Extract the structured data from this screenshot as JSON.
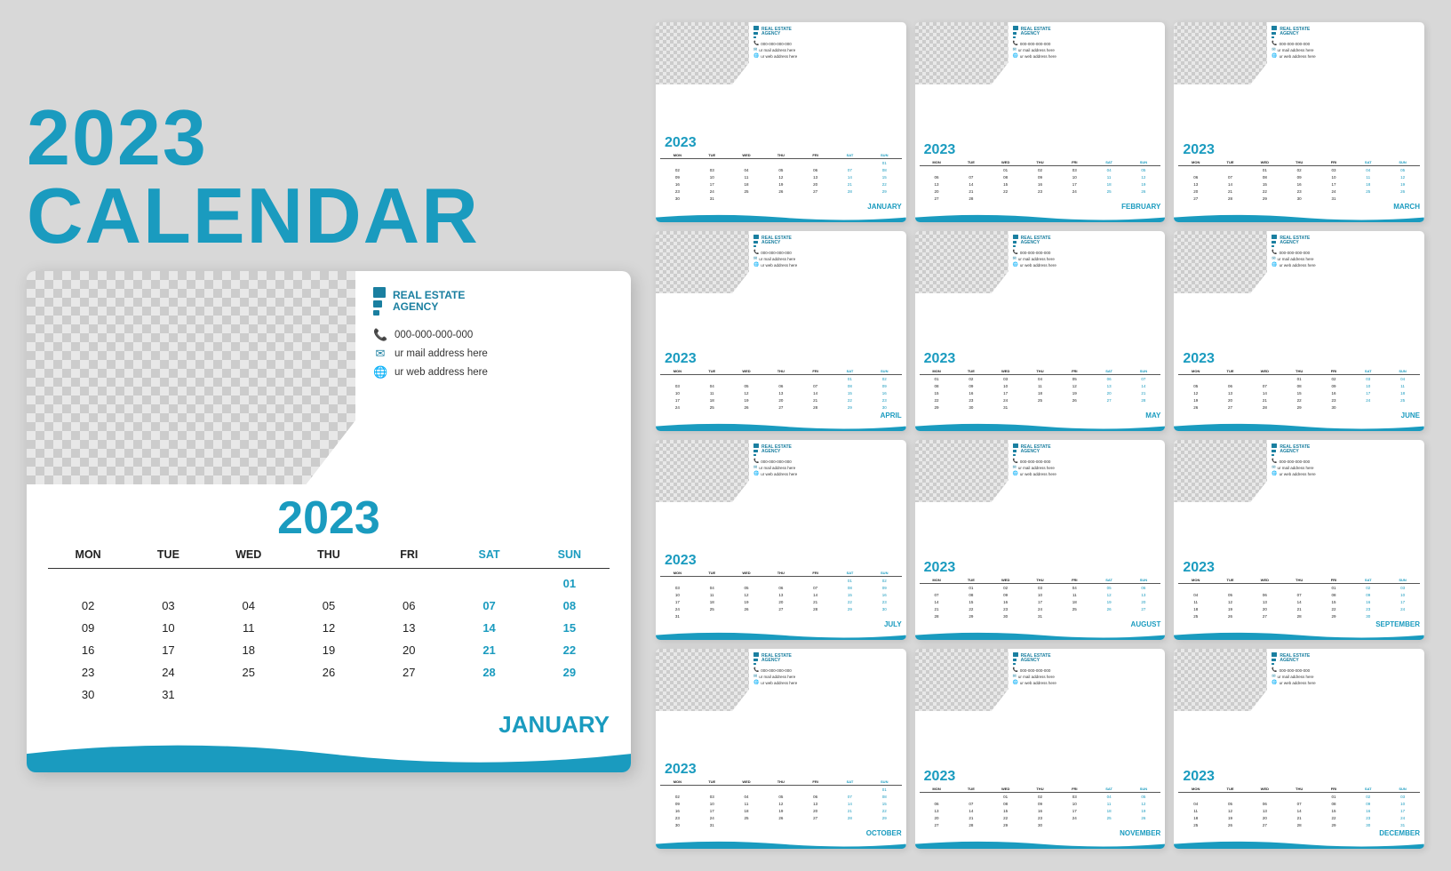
{
  "title": "2023 CALENDAR",
  "accent": "#1a9bbf",
  "bg": "#d8d8d8",
  "agency": {
    "name_line1": "REAL ESTATE",
    "name_line2": "AGENCY",
    "phone": "000-000-000-000",
    "email": "ur mail address here",
    "web": "ur web address here"
  },
  "main_year": "2023",
  "days": [
    "MON",
    "TUE",
    "WED",
    "THU",
    "FRI",
    "SAT",
    "SUN"
  ],
  "main_month": "JANUARY",
  "main_dates": [
    {
      "day": "",
      "weekend": false
    },
    {
      "day": "",
      "weekend": false
    },
    {
      "day": "",
      "weekend": false
    },
    {
      "day": "",
      "weekend": false
    },
    {
      "day": "",
      "weekend": false
    },
    {
      "day": "",
      "weekend": false
    },
    {
      "day": "01",
      "weekend": true
    },
    {
      "day": "02",
      "weekend": false
    },
    {
      "day": "03",
      "weekend": false
    },
    {
      "day": "04",
      "weekend": false
    },
    {
      "day": "05",
      "weekend": false
    },
    {
      "day": "06",
      "weekend": false
    },
    {
      "day": "07",
      "weekend": true
    },
    {
      "day": "08",
      "weekend": true
    },
    {
      "day": "09",
      "weekend": false
    },
    {
      "day": "10",
      "weekend": false
    },
    {
      "day": "11",
      "weekend": false
    },
    {
      "day": "12",
      "weekend": false
    },
    {
      "day": "13",
      "weekend": false
    },
    {
      "day": "14",
      "weekend": true
    },
    {
      "day": "15",
      "weekend": true
    },
    {
      "day": "16",
      "weekend": false
    },
    {
      "day": "17",
      "weekend": false
    },
    {
      "day": "18",
      "weekend": false
    },
    {
      "day": "19",
      "weekend": false
    },
    {
      "day": "20",
      "weekend": false
    },
    {
      "day": "21",
      "weekend": true
    },
    {
      "day": "22",
      "weekend": true
    },
    {
      "day": "23",
      "weekend": false
    },
    {
      "day": "24",
      "weekend": false
    },
    {
      "day": "25",
      "weekend": false
    },
    {
      "day": "26",
      "weekend": false
    },
    {
      "day": "27",
      "weekend": false
    },
    {
      "day": "28",
      "weekend": true
    },
    {
      "day": "29",
      "weekend": true
    },
    {
      "day": "30",
      "weekend": false
    },
    {
      "day": "31",
      "weekend": false
    },
    {
      "day": "",
      "weekend": false
    },
    {
      "day": "",
      "weekend": false
    },
    {
      "day": "",
      "weekend": false
    },
    {
      "day": "",
      "weekend": false
    },
    {
      "day": "",
      "weekend": false
    }
  ],
  "mini_calendars": [
    {
      "month": "JANUARY",
      "year": "2023"
    },
    {
      "month": "FEBRUARY",
      "year": "2023"
    },
    {
      "month": "MARCH",
      "year": "2023"
    },
    {
      "month": "APRIL",
      "year": "2023"
    },
    {
      "month": "MAY",
      "year": "2023"
    },
    {
      "month": "JUNE",
      "year": "2023"
    },
    {
      "month": "JULY",
      "year": "2023"
    },
    {
      "month": "AUGUST",
      "year": "2023"
    },
    {
      "month": "SEPTEMBER",
      "year": "2023"
    },
    {
      "month": "OCTOBER",
      "year": "2023"
    },
    {
      "month": "NOVEMBER",
      "year": "2023"
    },
    {
      "month": "DECEMBER",
      "year": "2023"
    }
  ]
}
